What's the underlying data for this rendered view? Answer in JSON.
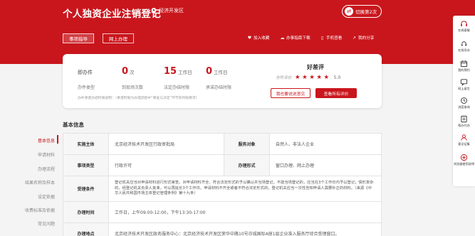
{
  "header": {
    "title": "个人独资企业注销登记",
    "location": "经济开发区",
    "switch_label": "切换第2次",
    "btn_online": "事项指导",
    "btn_offline": "网上办理",
    "quick_links": [
      {
        "label": "加入收藏",
        "icon": "heart-icon"
      },
      {
        "label": "办事指南下载",
        "icon": "cloud-icon"
      },
      {
        "label": "手机查看",
        "icon": "phone-icon"
      },
      {
        "label": "我的分享",
        "icon": "share-icon"
      }
    ]
  },
  "summary": {
    "stats": [
      {
        "value": "即办件",
        "label": "办件类型"
      },
      {
        "value": "0",
        "unit": "次",
        "label": "到现场次数"
      },
      {
        "value": "15",
        "unit": "工作日",
        "label": "法定办结时限"
      },
      {
        "value": "0",
        "unit": "工作日",
        "label": "承诺办结时限"
      }
    ],
    "note": "办件承诺办结时限说明：（承诺时限为办理流程中“审查与决定”环节的时限要求）",
    "evaluation": {
      "title": "好差评",
      "label": "办件评价",
      "stars": "★★★★★",
      "score": "5.0",
      "btn_suggest": "我也要说说意见",
      "btn_view": "查看所有评价"
    }
  },
  "section_title": "基本信息",
  "tabs": [
    "基本信息",
    "申请材料",
    "办理流程",
    "结果名称及样本",
    "设定依据",
    "收费标准及依据",
    "常见问题"
  ],
  "table": {
    "rows": [
      {
        "k1": "实施主体",
        "v1": "北京经济技术开发区行政审批局",
        "k2": "服务对象",
        "v2": "自然人、非法人企业"
      },
      {
        "k1": "事项类型",
        "v1": "行政许可",
        "k2": "办理形式",
        "v2": "窗口办理、网上办理"
      },
      {
        "k1": "受理条件",
        "v1": "登记机关应当对申请材料进行形式审查。对申请材料齐全、符合法定形式的予以确认并当场登记。不能当场登记的，应当在3个工作日内予以登记；情形复杂的，经登记机关负责人批准，可以再延长3个工作日。申请材料不齐全或者不符合法定形式的，登记机关应当一次性告知申请人需要补正的材料。（来源《中华人民共和国市场主体登记管理条例》第十九条）"
      },
      {
        "k1": "办理时间",
        "v1": "工作日，上午09:00-12:00，下午13:30-17:00"
      },
      {
        "k1": "办理地点",
        "v1": "北京经济技术开发区政务服务中心：北京经济技术开发区荣华中路10号亦城国际A座1层企业准入服务厅综合受理窗口。"
      }
    ]
  },
  "float_bar": [
    {
      "label": "在线客服",
      "icon": "headset-icon"
    },
    {
      "label": "在线导办",
      "icon": "guide-icon"
    },
    {
      "label": "我的预约",
      "icon": "calendar-icon"
    },
    {
      "label": "网上留言",
      "icon": "message-icon"
    },
    {
      "label": "进度查询",
      "icon": "progress-icon"
    },
    {
      "label": "帮办代办",
      "icon": "help-icon"
    },
    {
      "label": "意见征集",
      "icon": "feedback-icon"
    },
    {
      "label": "浏览器使用说明",
      "icon": "browser-icon"
    }
  ],
  "colors": {
    "brand": "#c9161d",
    "background": "#f4f4f4"
  }
}
